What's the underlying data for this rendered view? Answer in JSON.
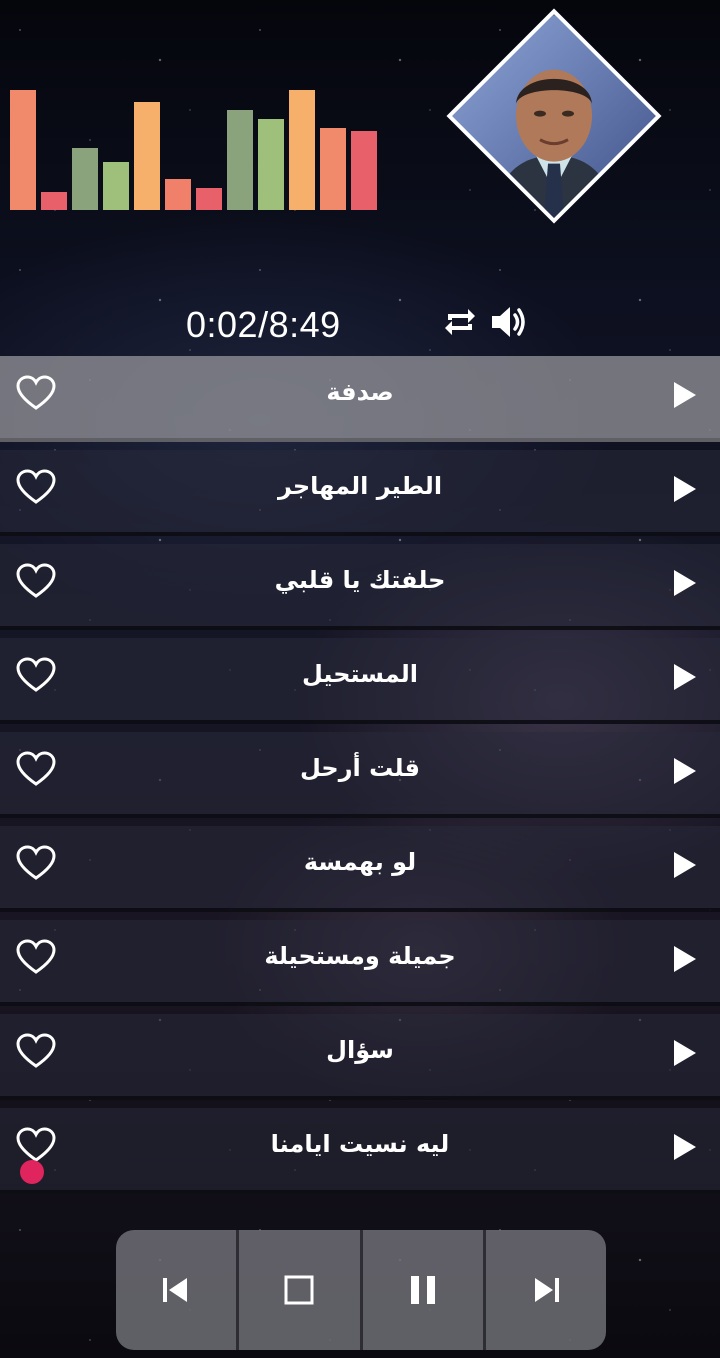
{
  "player": {
    "time": "0:02/8:49",
    "controls": [
      "repeat-icon",
      "volume-icon"
    ]
  },
  "visualizer": {
    "levels": [
      1.0,
      0.15,
      0.52,
      0.4,
      0.9,
      0.26,
      0.18,
      0.83,
      0.76,
      1.0,
      0.68,
      0.66
    ],
    "colors": [
      "#f08a6b",
      "#e8606a",
      "#8aa37c",
      "#9fc07a",
      "#f6b06b",
      "#f0806a",
      "#e8606a",
      "#8aa37c",
      "#9fc07a",
      "#f6b06b",
      "#f08a6b",
      "#e8606a"
    ]
  },
  "songs": [
    {
      "title": "صدفة",
      "active": true
    },
    {
      "title": "الطير المهاجر",
      "active": false
    },
    {
      "title": "حلفتك يا قلبي",
      "active": false
    },
    {
      "title": "المستحيل",
      "active": false
    },
    {
      "title": "قلت أرحل",
      "active": false
    },
    {
      "title": "لو بهمسة",
      "active": false
    },
    {
      "title": "جميلة ومستحيلة",
      "active": false
    },
    {
      "title": "سؤال",
      "active": false
    },
    {
      "title": "ليه نسيت ايامنا",
      "active": false
    }
  ],
  "transport": [
    "previous-icon",
    "stop-icon",
    "pause-icon",
    "next-icon"
  ],
  "colors": {
    "accent_dot": "#e0245e",
    "active_row": "#9a9a9f"
  }
}
